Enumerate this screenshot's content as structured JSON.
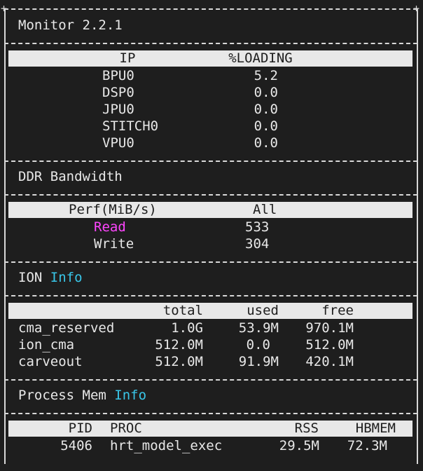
{
  "app": {
    "title": "Monitor 2.2.1"
  },
  "ip_table": {
    "headers": [
      "IP",
      "%LOADING"
    ],
    "rows": [
      {
        "ip": "BPU0",
        "loading": "5.2"
      },
      {
        "ip": "DSP0",
        "loading": "0.0"
      },
      {
        "ip": "JPU0",
        "loading": "0.0"
      },
      {
        "ip": "STITCH0",
        "loading": "0.0"
      },
      {
        "ip": "VPU0",
        "loading": "0.0"
      }
    ]
  },
  "ddr": {
    "title": "DDR Bandwidth",
    "headers": [
      "Perf(MiB/s)",
      "All"
    ],
    "rows": [
      {
        "label": "Read",
        "value": "533",
        "color": "#ff45ff"
      },
      {
        "label": "Write",
        "value": "304"
      }
    ]
  },
  "ion": {
    "title_prefix": "ION",
    "title_highlight": "Info",
    "headers": [
      "total",
      "used",
      "free"
    ],
    "rows": [
      {
        "name": "cma_reserved",
        "total": "1.0G",
        "used": "53.9M",
        "free": "970.1M"
      },
      {
        "name": "ion_cma",
        "total": "512.0M",
        "used": "0.0",
        "free": "512.0M"
      },
      {
        "name": "carveout",
        "total": "512.0M",
        "used": "91.9M",
        "free": "420.1M"
      }
    ]
  },
  "process_mem": {
    "title_prefix": "Process Mem",
    "title_highlight": "Info",
    "headers": [
      "PID",
      "PROC",
      "RSS",
      "HBMEM"
    ],
    "rows": [
      {
        "pid": "5406",
        "proc": "hrt_model_exec",
        "rss": "29.5M",
        "hbmem": "72.3M"
      }
    ]
  },
  "colors": {
    "background": "#1e1e1e",
    "text": "#e8e8e8",
    "highlight_info": "#39c6e8",
    "highlight_read": "#ff45ff",
    "header_bar": "#e8e8e8"
  }
}
